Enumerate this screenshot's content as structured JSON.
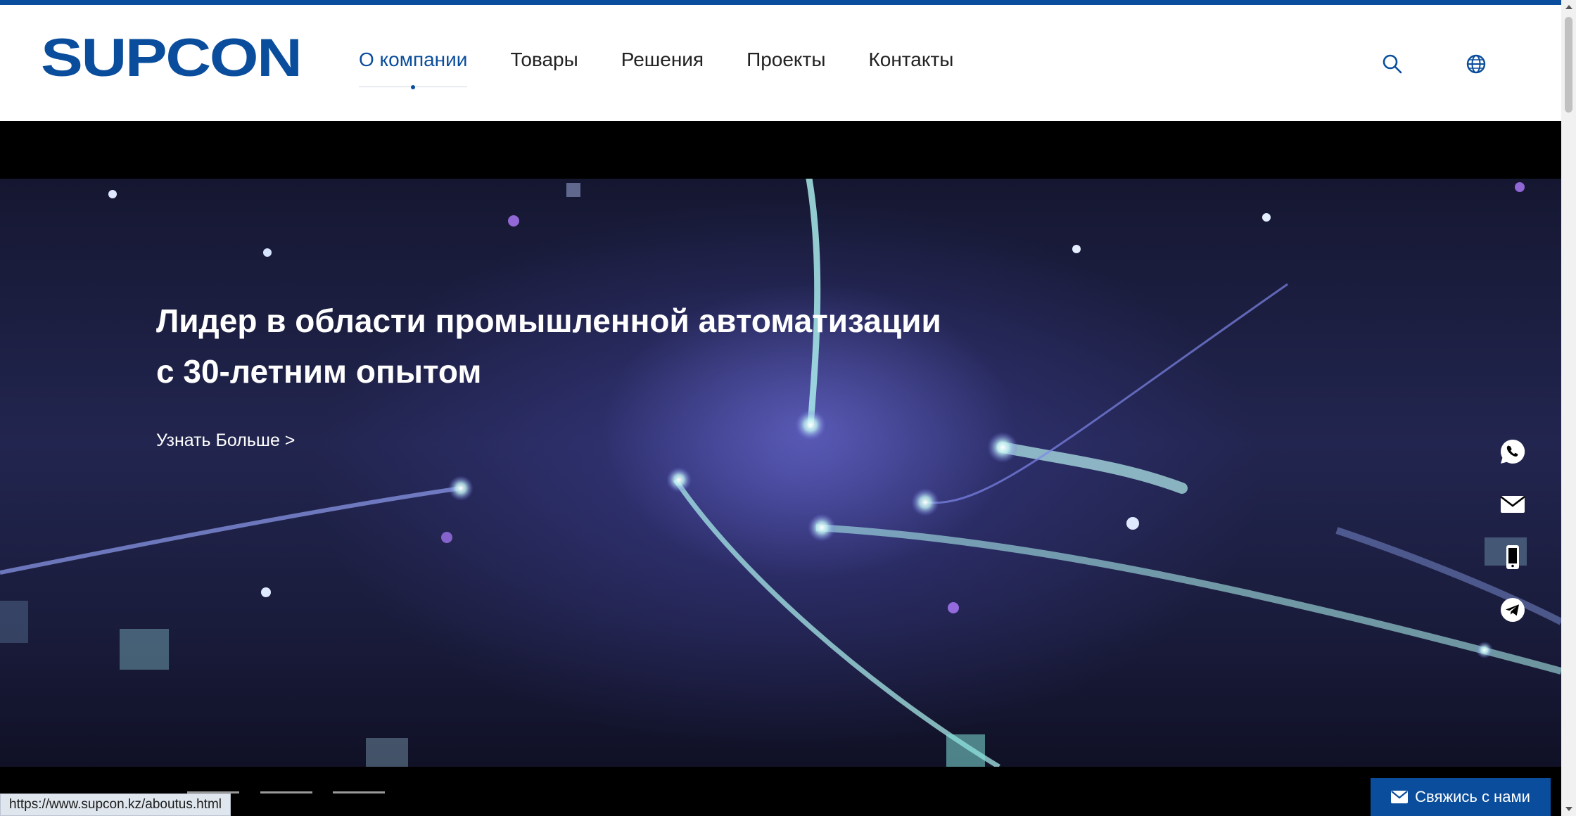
{
  "brand": {
    "logo_text": "SUPCON",
    "accent_color": "#0a4d9c"
  },
  "nav": {
    "items": [
      {
        "label": "О компании",
        "active": true
      },
      {
        "label": "Товары"
      },
      {
        "label": "Решения"
      },
      {
        "label": "Проекты"
      },
      {
        "label": "Контакты"
      }
    ]
  },
  "header_icons": [
    "search-icon",
    "globe-icon"
  ],
  "hero": {
    "title_line1": "Лидер в области промышленной автоматизации",
    "title_line2": "с 30-летним опытом",
    "link_label": "Узнать Больше >"
  },
  "side_contacts": [
    "whatsapp-icon",
    "mail-icon",
    "phone-icon",
    "telegram-icon"
  ],
  "slider": {
    "dots": 3,
    "active_index": 0
  },
  "contact_button": {
    "label": "Свяжись с нами",
    "icon": "envelope-icon"
  },
  "status_bar": {
    "url": "https://www.supcon.kz/aboutus.html"
  }
}
